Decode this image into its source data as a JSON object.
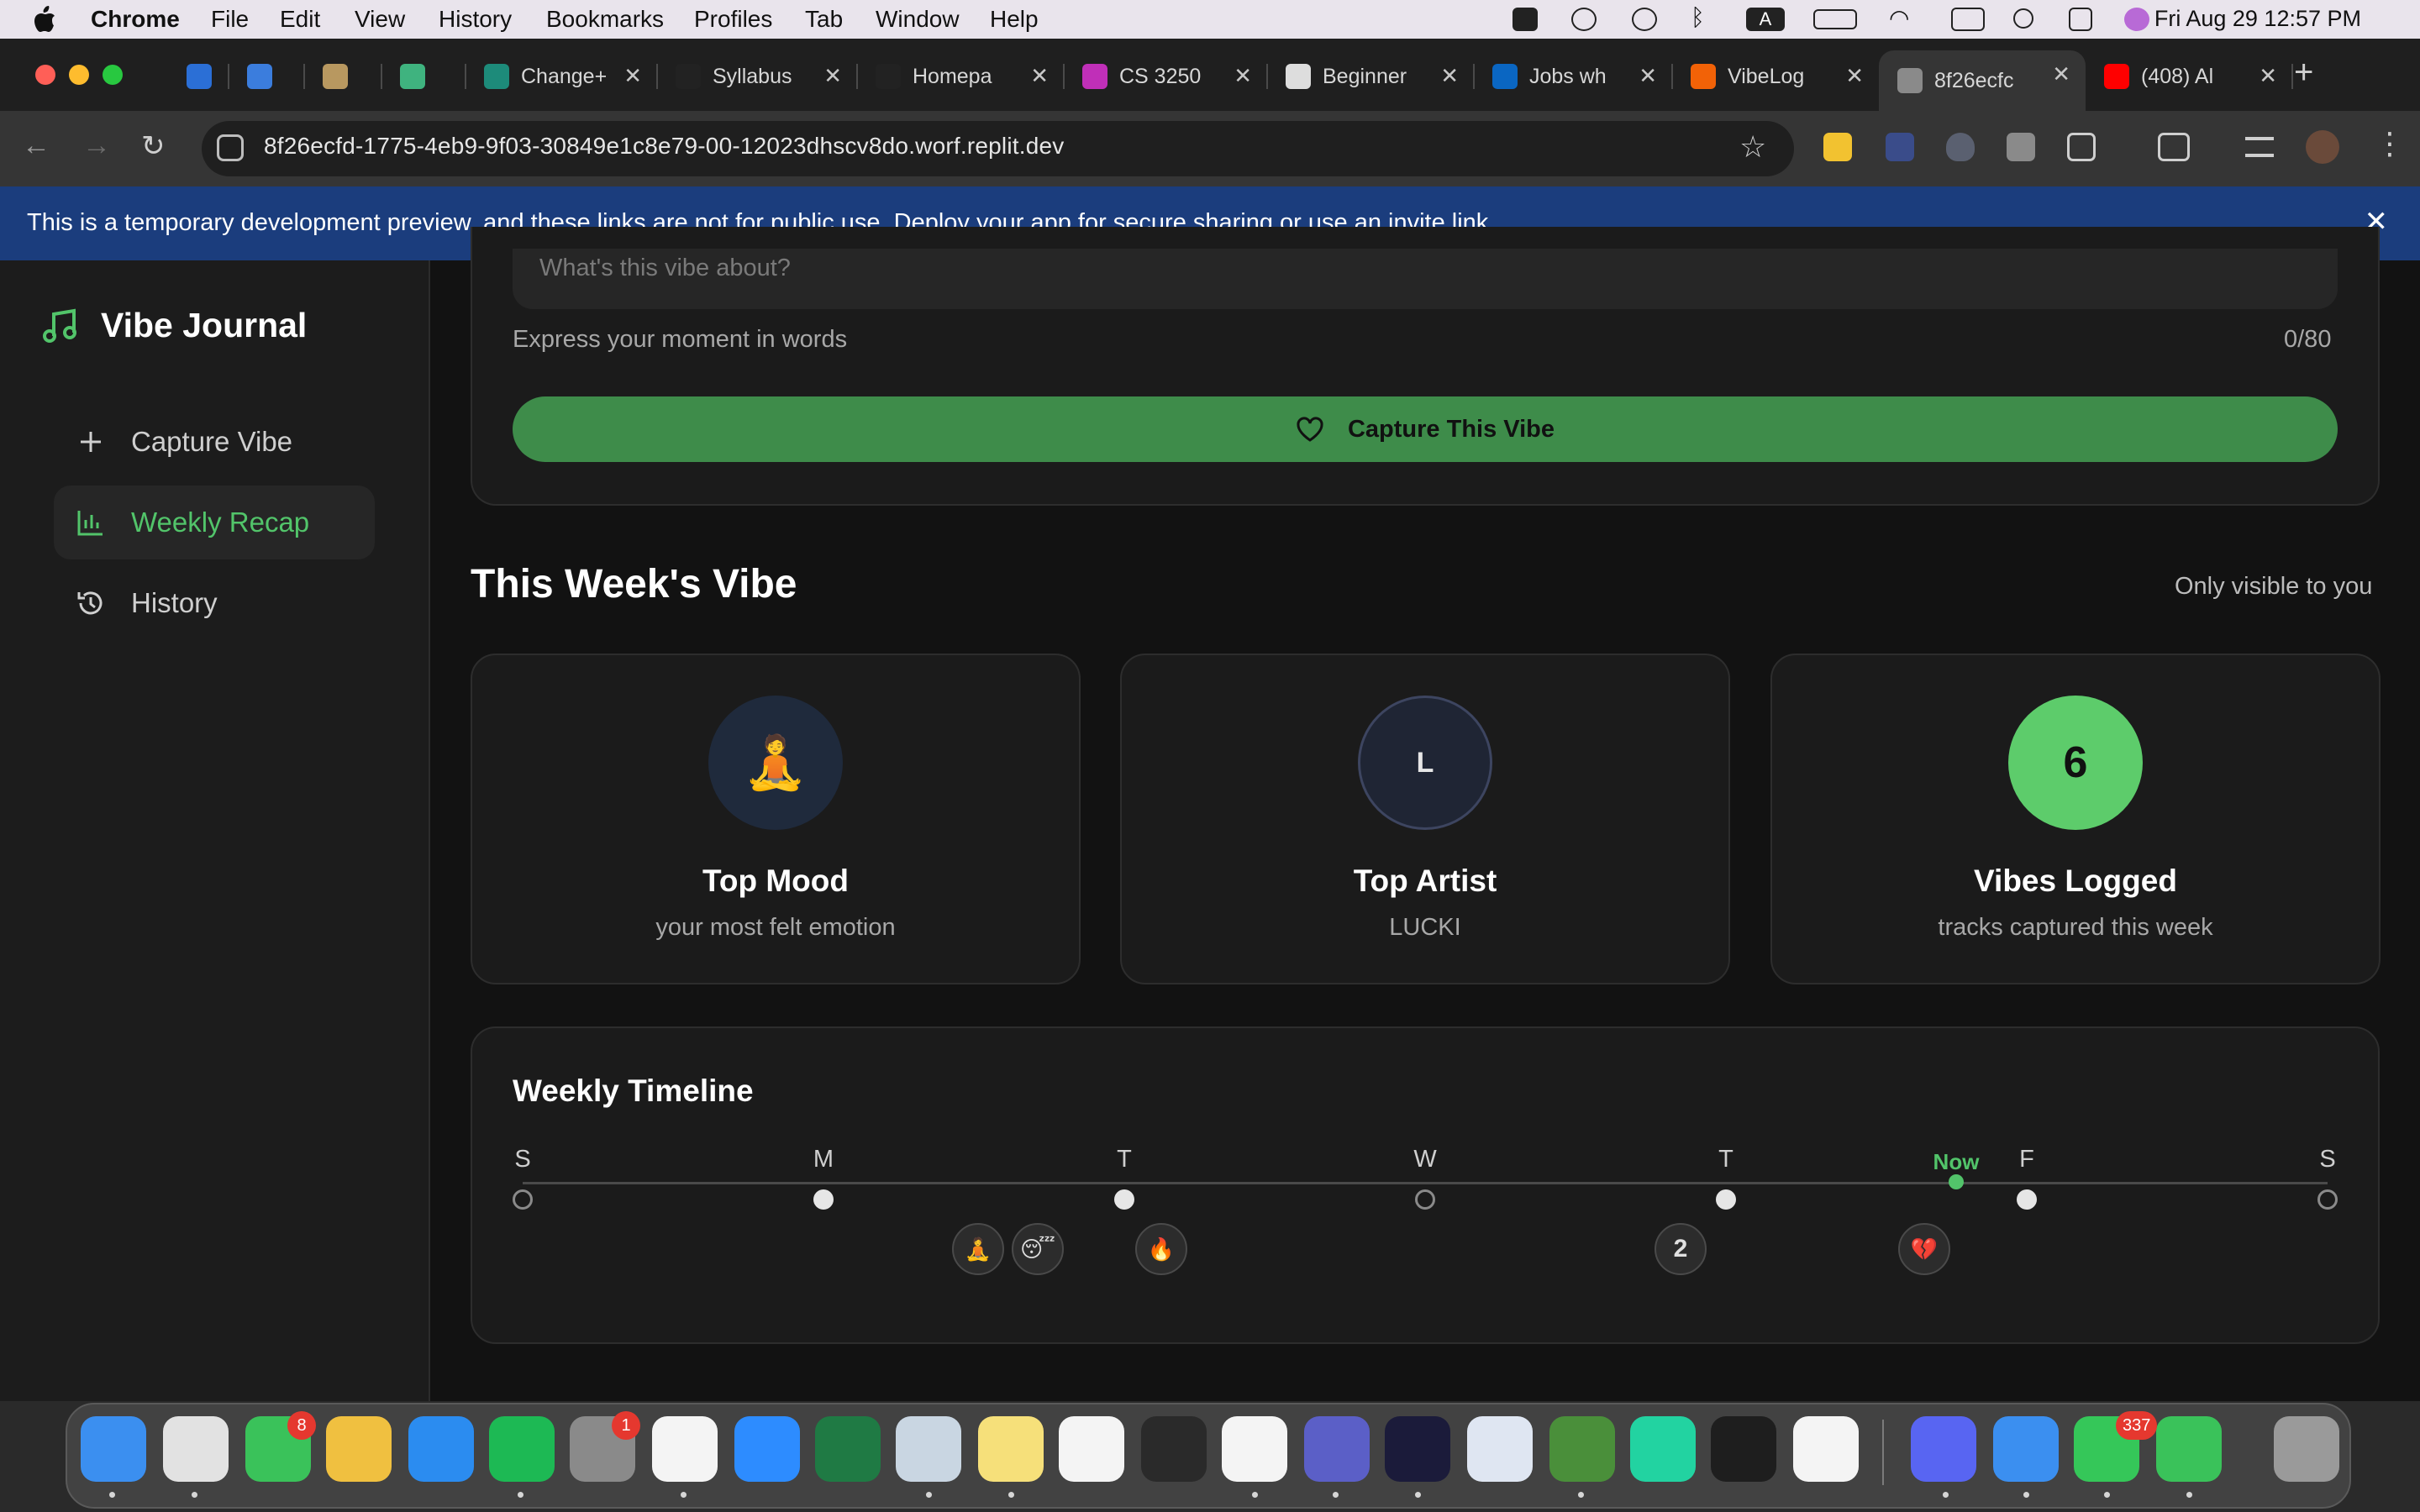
{
  "menubar": {
    "app": "Chrome",
    "items": [
      "File",
      "Edit",
      "View",
      "History",
      "Bookmarks",
      "Profiles",
      "Tab",
      "Window",
      "Help"
    ],
    "clock": "Fri Aug 29  12:57 PM"
  },
  "tabs": [
    {
      "title": "",
      "color": "#2b6fd6"
    },
    {
      "title": "",
      "color": "#3b7ddd"
    },
    {
      "title": "",
      "color": "#b89860"
    },
    {
      "title": "",
      "color": "#3fb37f"
    },
    {
      "title": "Change+",
      "color": "#1d8b7a"
    },
    {
      "title": "Syllabus",
      "color": "#222222"
    },
    {
      "title": "Homepa",
      "color": "#222222"
    },
    {
      "title": "CS 3250",
      "color": "#c02fb8"
    },
    {
      "title": "Beginner",
      "color": "#dddddd"
    },
    {
      "title": "Jobs wh",
      "color": "#0a66c2"
    },
    {
      "title": "VibeLog",
      "color": "#f26207"
    },
    {
      "title": "8f26ecfc",
      "color": "#8a8a8a"
    },
    {
      "title": "(408) Al",
      "color": "#ff0000"
    }
  ],
  "address": {
    "url": "8f26ecfd-1775-4eb9-9f03-30849e1c8e79-00-12023dhscv8do.worf.replit.dev"
  },
  "banner": {
    "before": "This is a temporary development preview, and these links are not for public use. ",
    "link": "Deploy your app",
    "after": " for secure sharing or use an invite link."
  },
  "sidebar": {
    "brand": "Vibe Journal",
    "items": [
      {
        "label": "Capture Vibe",
        "icon": "plus-icon"
      },
      {
        "label": "Weekly Recap",
        "icon": "bar-chart-icon",
        "active": true
      },
      {
        "label": "History",
        "icon": "history-icon"
      }
    ]
  },
  "capture": {
    "placeholder": "What's this vibe about?",
    "hint": "Express your moment in words",
    "counter": "0/80",
    "button": "Capture This Vibe"
  },
  "week": {
    "title": "This Week's Vibe",
    "visibility": "Only visible to you",
    "cards": [
      {
        "glyph": "🧘",
        "title": "Top Mood",
        "subtitle": "your most felt emotion"
      },
      {
        "glyph": "L",
        "title": "Top Artist",
        "subtitle": "LUCKI"
      },
      {
        "glyph": "6",
        "title": "Vibes Logged",
        "subtitle": "tracks captured this week"
      }
    ]
  },
  "timeline": {
    "title": "Weekly Timeline",
    "now_label": "Now",
    "days": [
      "S",
      "M",
      "T",
      "W",
      "T",
      "F",
      "S"
    ],
    "day_filled": [
      false,
      true,
      true,
      false,
      true,
      true,
      false
    ],
    "entries": [
      "🧘",
      "😴",
      "🔥",
      "2",
      "💔"
    ]
  },
  "colors": {
    "accent": "#4caf50",
    "accent_text": "#52c46a",
    "banner": "#1b3d7d"
  }
}
